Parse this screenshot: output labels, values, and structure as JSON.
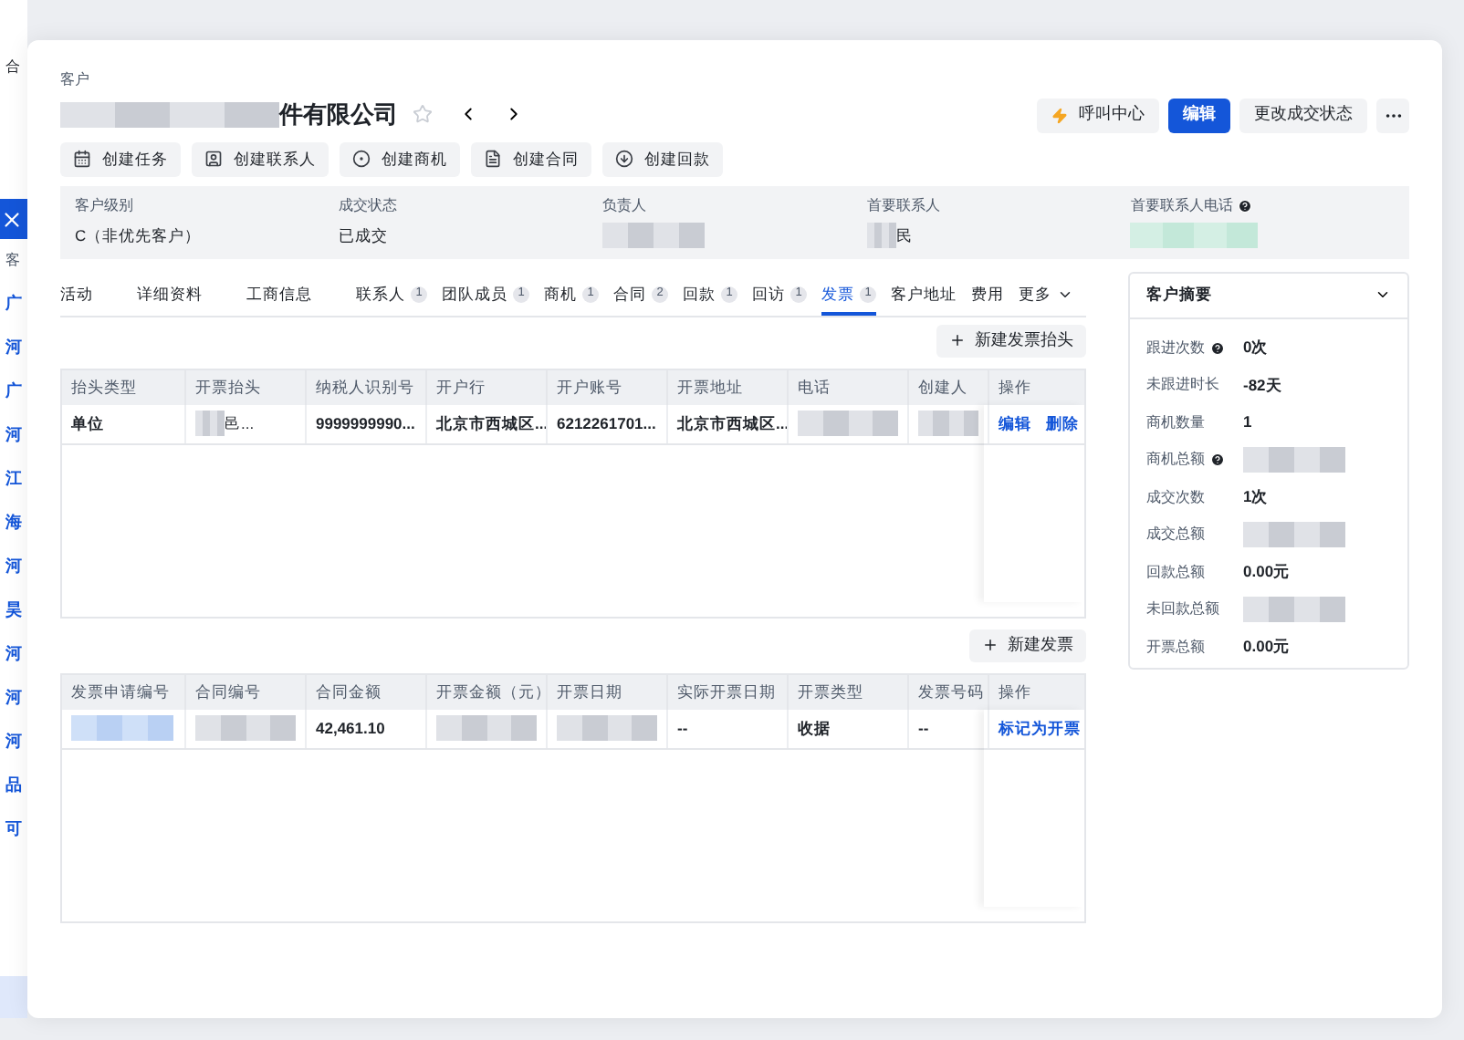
{
  "background_list": {
    "header": "合",
    "column_label": "客",
    "rows": [
      "广",
      "河",
      "广",
      "河",
      "江",
      "海",
      "河",
      "昊",
      "河",
      "河",
      "河",
      "品",
      "可"
    ]
  },
  "header": {
    "label": "客户",
    "title": "件有限公司",
    "starred": false
  },
  "header_buttons": [
    {
      "kind": "call",
      "label": "呼叫中心"
    },
    {
      "kind": "primary",
      "label": "编辑"
    },
    {
      "kind": "default",
      "label": "更改成交状态"
    },
    {
      "kind": "more"
    }
  ],
  "action_buttons": [
    {
      "kind": "task",
      "label": "创建任务"
    },
    {
      "kind": "contact",
      "label": "创建联系人"
    },
    {
      "kind": "opportunity",
      "label": "创建商机"
    },
    {
      "kind": "contract",
      "label": "创建合同"
    },
    {
      "kind": "payment",
      "label": "创建回款"
    }
  ],
  "info_fields": [
    {
      "label": "客户级别",
      "value": {
        "kind": "text",
        "text": "C（非优先客户）"
      }
    },
    {
      "label": "成交状态",
      "value": {
        "kind": "text",
        "text": "已成交"
      }
    },
    {
      "label": "负责人",
      "value": {
        "kind": "redacted"
      }
    },
    {
      "label": "首要联系人",
      "value": {
        "kind": "partial",
        "text": "民"
      }
    },
    {
      "label": "首要联系人电话",
      "help": true,
      "value": {
        "kind": "redacted_green"
      }
    }
  ],
  "tabs": [
    {
      "label": "活动",
      "selected": false
    },
    {
      "label": "详细资料",
      "selected": false
    },
    {
      "label": "工商信息",
      "selected": false
    },
    {
      "label": "联系人",
      "count": "1",
      "selected": false
    },
    {
      "label": "团队成员",
      "count": "1",
      "selected": false
    },
    {
      "label": "商机",
      "count": "1",
      "selected": false
    },
    {
      "label": "合同",
      "count": "2",
      "selected": false
    },
    {
      "label": "回款",
      "count": "1",
      "selected": false
    },
    {
      "label": "回访",
      "count": "1",
      "selected": false
    },
    {
      "label": "发票",
      "count": "1",
      "selected": true
    },
    {
      "label": "客户地址",
      "selected": false
    },
    {
      "label": "费用",
      "selected": false
    },
    {
      "label": "更多",
      "dropdown": true,
      "selected": false
    }
  ],
  "invoice_title_table": {
    "add_button": "新建发票抬头",
    "columns": [
      "抬头类型",
      "开票抬头",
      "纳税人识别号",
      "开户行",
      "开户账号",
      "开票地址",
      "电话",
      "创建人",
      "操作"
    ],
    "rows": [
      [
        {
          "kind": "text",
          "text": "单位"
        },
        {
          "kind": "partial",
          "text": "邑..."
        },
        {
          "kind": "text",
          "text": "9999999990..."
        },
        {
          "kind": "text",
          "text": "北京市西城区..."
        },
        {
          "kind": "text",
          "text": "6212261701..."
        },
        {
          "kind": "text",
          "text": "北京市西城区..."
        },
        {
          "kind": "redacted"
        },
        {
          "kind": "redacted"
        },
        {
          "kind": "links",
          "links": [
            "编辑",
            "删除"
          ]
        }
      ]
    ]
  },
  "invoice_table": {
    "add_button": "新建发票",
    "columns": [
      "发票申请编号",
      "合同编号",
      "合同金额",
      "开票金额（元）",
      "开票日期",
      "实际开票日期",
      "开票类型",
      "发票号码",
      "操作"
    ],
    "rows": [
      [
        {
          "kind": "redacted_blue"
        },
        {
          "kind": "redacted"
        },
        {
          "kind": "text",
          "text": "42,461.10"
        },
        {
          "kind": "redacted"
        },
        {
          "kind": "redacted"
        },
        {
          "kind": "text",
          "text": "--"
        },
        {
          "kind": "text",
          "text": "收据"
        },
        {
          "kind": "text",
          "text": "--"
        },
        {
          "kind": "links",
          "links": [
            "标记为开票"
          ]
        }
      ]
    ]
  },
  "summary": {
    "title": "客户摘要",
    "expanded": true,
    "rows": [
      {
        "label": "跟进次数",
        "help": true,
        "value": {
          "kind": "text",
          "text": "0次"
        }
      },
      {
        "label": "未跟进时长",
        "value": {
          "kind": "text",
          "text": "-82天"
        }
      },
      {
        "label": "商机数量",
        "value": {
          "kind": "text",
          "text": "1"
        }
      },
      {
        "label": "商机总额",
        "help": true,
        "value": {
          "kind": "redacted"
        }
      },
      {
        "label": "成交次数",
        "value": {
          "kind": "text",
          "text": "1次"
        }
      },
      {
        "label": "成交总额",
        "value": {
          "kind": "redacted"
        }
      },
      {
        "label": "回款总额",
        "value": {
          "kind": "text",
          "text": "0.00元"
        }
      },
      {
        "label": "未回款总额",
        "value": {
          "kind": "redacted"
        }
      },
      {
        "label": "开票总额",
        "value": {
          "kind": "text",
          "text": "0.00元"
        }
      }
    ]
  }
}
